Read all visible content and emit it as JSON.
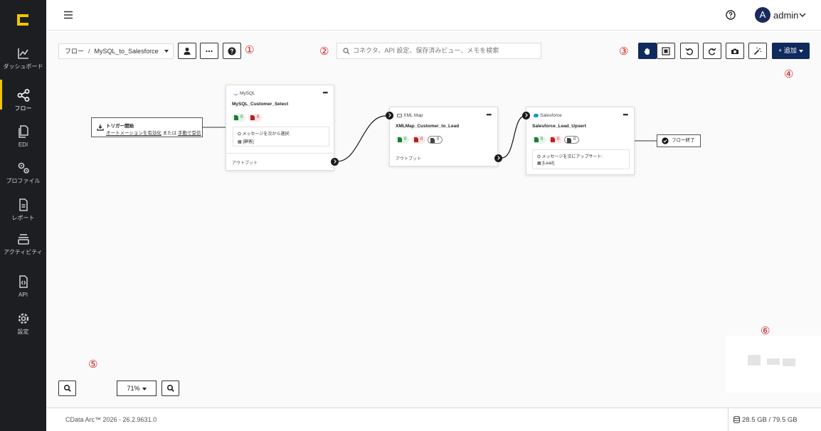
{
  "sidebar": {
    "items": [
      {
        "label": "ダッシュボード",
        "icon": "chart-line-icon"
      },
      {
        "label": "フロー",
        "icon": "share-nodes-icon",
        "active": true
      },
      {
        "label": "EDI",
        "icon": "documents-icon"
      },
      {
        "label": "プロファイル",
        "icon": "gears-icon"
      },
      {
        "label": "レポート",
        "icon": "report-icon"
      },
      {
        "label": "アクティビティ",
        "icon": "activity-layers-icon"
      },
      {
        "label": "API",
        "icon": "api-file-icon"
      },
      {
        "label": "設定",
        "icon": "gear-icon"
      }
    ],
    "accent_color": "#f2c500"
  },
  "header": {
    "avatar_letter": "A",
    "username": "admin"
  },
  "toolbar": {
    "breadcrumb_root": "フロー",
    "breadcrumb_sep": "/",
    "breadcrumb_current": "MySQL_to_Salesforce",
    "search_placeholder": "コネクタ、API 設定、保存済みビュー、メモを検索",
    "add_label": "+ 追加"
  },
  "annotations": [
    "①",
    "②",
    "③",
    "④",
    "⑤",
    "⑥"
  ],
  "flow": {
    "trigger_title": "トリガー開始",
    "trigger_link1": "オートメーションを有効化",
    "trigger_mid": " または ",
    "trigger_link2": "手動で受信",
    "end_label": "フロー終了",
    "nodes": [
      {
        "kind": "MySQL",
        "name": "MySQL_Customer_Select",
        "success": "0",
        "error": "0",
        "msg_line1": "メッセージを次から選択:",
        "msg_line2": "[顧客]",
        "output": "アウトプット"
      },
      {
        "kind": "XML Map",
        "name": "XMLMap_Customer_to_Lead",
        "success": "0",
        "error": "0",
        "neutral": "0",
        "output": "アウトプット"
      },
      {
        "kind": "Salesforce",
        "name": "Salesforce_Lead_Upsert",
        "success": "0",
        "error": "0",
        "neutral": "0",
        "msg_line1": "メッセージを次にアップサート:",
        "msg_line2": "[Lead]"
      }
    ]
  },
  "zoom": {
    "level": "71%"
  },
  "footer": {
    "version": "CData Arc™ 2026 - 26.2.9631.0",
    "disk": "28.5 GB / 79.5 GB"
  }
}
